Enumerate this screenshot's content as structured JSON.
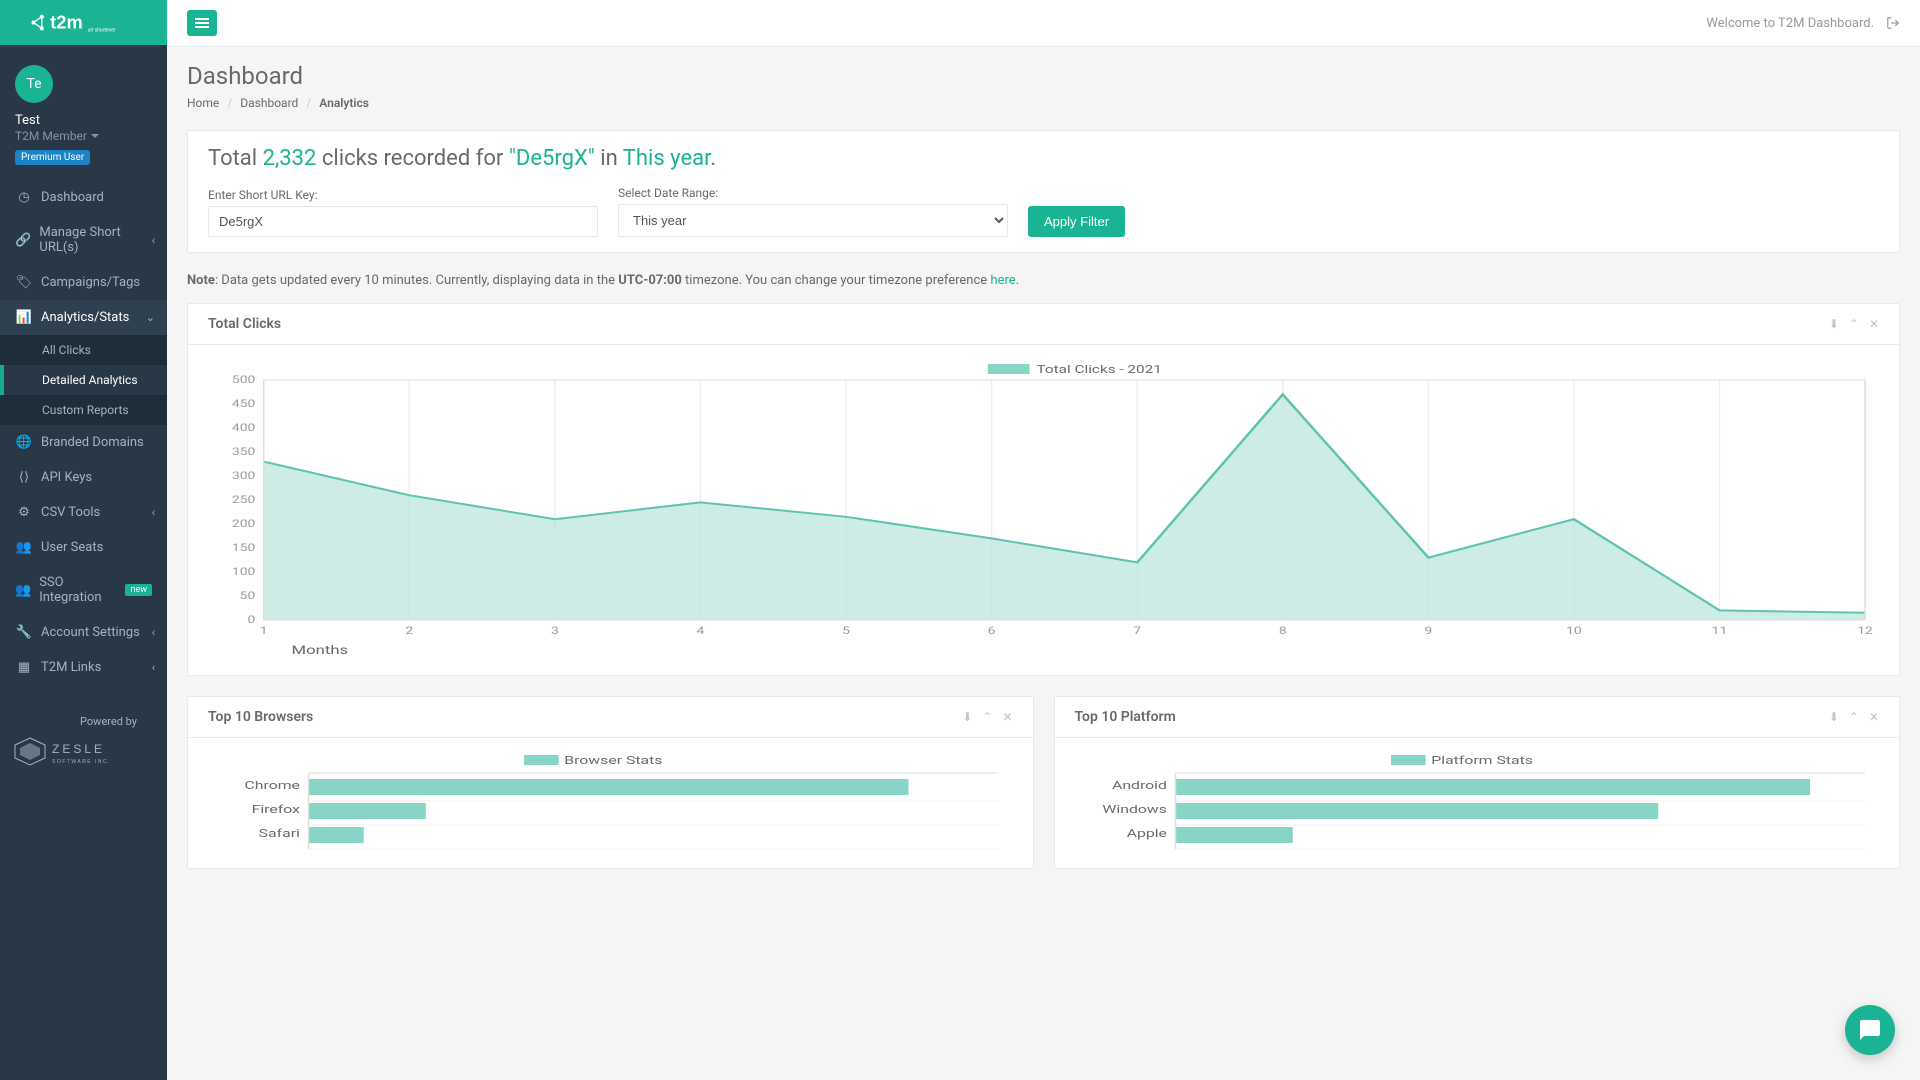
{
  "brand": {
    "name": "t2m",
    "tag": "url shortener"
  },
  "user": {
    "initials": "Te",
    "name": "Test",
    "role": "T2M Member",
    "badge": "Premium User"
  },
  "sidebar": {
    "items": [
      {
        "label": "Dashboard",
        "icon": "dashboard"
      },
      {
        "label": "Manage Short URL(s)",
        "icon": "link",
        "sub": true
      },
      {
        "label": "Campaigns/Tags",
        "icon": "tag"
      },
      {
        "label": "Analytics/Stats",
        "icon": "bar",
        "sub": true,
        "open": true,
        "children": [
          {
            "label": "All Clicks"
          },
          {
            "label": "Detailed Analytics",
            "active": true
          },
          {
            "label": "Custom Reports"
          }
        ]
      },
      {
        "label": "Branded Domains",
        "icon": "globe"
      },
      {
        "label": "API Keys",
        "icon": "code"
      },
      {
        "label": "CSV Tools",
        "icon": "sliders",
        "sub": true
      },
      {
        "label": "User Seats",
        "icon": "users"
      },
      {
        "label": "SSO Integration",
        "icon": "users",
        "badge": "new"
      },
      {
        "label": "Account Settings",
        "icon": "wrench",
        "sub": true
      },
      {
        "label": "T2M Links",
        "icon": "grid",
        "sub": true
      }
    ],
    "powered_label": "Powered by",
    "powered_name": "ZESLE SOFTWARE INC."
  },
  "topbar": {
    "welcome": "Welcome to T2M Dashboard."
  },
  "page": {
    "title": "Dashboard",
    "breadcrumb": [
      {
        "label": "Home",
        "link": true
      },
      {
        "label": "Dashboard",
        "link": true
      },
      {
        "label": "Analytics",
        "link": false
      }
    ]
  },
  "summary": {
    "prefix": "Total ",
    "count": "2,332",
    "mid1": " clicks recorded for ",
    "key": "\"De5rgX\"",
    "mid2": " in ",
    "range": "This year",
    "suffix": "."
  },
  "filter": {
    "url_label": "Enter Short URL Key:",
    "url_value": "De5rgX",
    "range_label": "Select Date Range:",
    "range_value": "This year",
    "apply": "Apply Filter"
  },
  "note": {
    "label": "Note",
    "text1": ": Data gets updated every 10 minutes. Currently, displaying data in the ",
    "tz": "UTC-07:00",
    "text2": " timezone. You can change your timezone preference ",
    "link": "here",
    "text3": "."
  },
  "charts": {
    "total_title": "Total Clicks",
    "browsers_title": "Top 10 Browsers",
    "platform_title": "Top 10 Platform"
  },
  "chart_data": [
    {
      "id": "total_clicks",
      "type": "area",
      "title": "Total Clicks",
      "series": [
        {
          "name": "Total Clicks - 2021",
          "values": [
            330,
            260,
            210,
            245,
            215,
            170,
            120,
            470,
            130,
            210,
            20,
            15
          ]
        }
      ],
      "x": [
        1,
        2,
        3,
        4,
        5,
        6,
        7,
        8,
        9,
        10,
        11,
        12
      ],
      "xlabel": "Months",
      "ylabel": "",
      "ylim": [
        0,
        500
      ],
      "yticks": [
        0,
        50,
        100,
        150,
        200,
        250,
        300,
        350,
        400,
        450,
        500
      ]
    },
    {
      "id": "browsers",
      "type": "bar",
      "orientation": "horizontal",
      "title": "Top 10 Browsers",
      "legend": "Browser Stats",
      "categories": [
        "Chrome",
        "Firefox",
        "Safari"
      ],
      "values": [
        870,
        170,
        80
      ],
      "xlim": [
        0,
        1000
      ]
    },
    {
      "id": "platform",
      "type": "bar",
      "orientation": "horizontal",
      "title": "Top 10 Platform",
      "legend": "Platform Stats",
      "categories": [
        "Android",
        "Windows",
        "Apple"
      ],
      "values": [
        920,
        700,
        170
      ],
      "xlim": [
        0,
        1000
      ]
    }
  ]
}
